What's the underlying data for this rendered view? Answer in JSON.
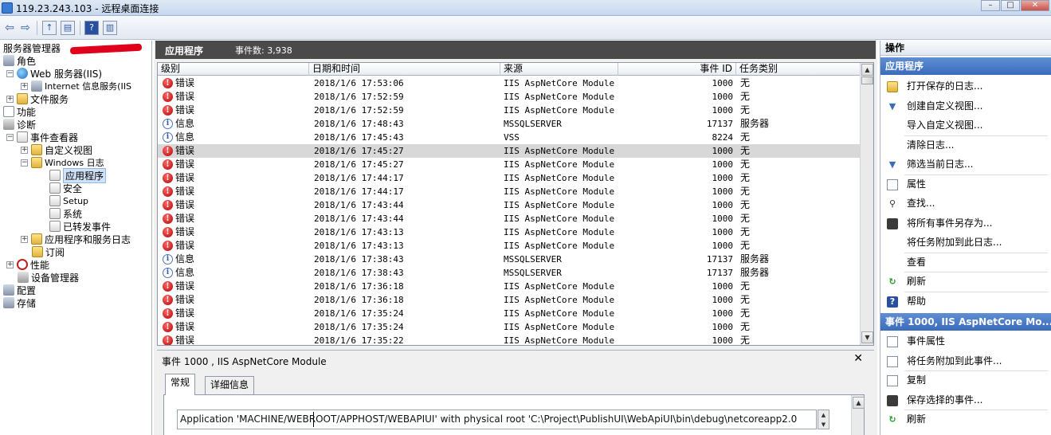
{
  "window": {
    "title": "119.23.243.103 - 远程桌面连接"
  },
  "tree": {
    "root": "服务器管理器",
    "items": [
      {
        "label": "角色"
      },
      {
        "label": "Web 服务器(IIS)"
      },
      {
        "label": "Internet 信息服务(IIS"
      },
      {
        "label": "文件服务"
      },
      {
        "label": "功能"
      },
      {
        "label": "诊断"
      },
      {
        "label": "事件查看器"
      },
      {
        "label": "自定义视图"
      },
      {
        "label": "Windows 日志"
      },
      {
        "label": "应用程序"
      },
      {
        "label": "安全"
      },
      {
        "label": "Setup"
      },
      {
        "label": "系统"
      },
      {
        "label": "已转发事件"
      },
      {
        "label": "应用程序和服务日志"
      },
      {
        "label": "订阅"
      },
      {
        "label": "性能"
      },
      {
        "label": "设备管理器"
      },
      {
        "label": "配置"
      },
      {
        "label": "存储"
      }
    ]
  },
  "center": {
    "title": "应用程序",
    "count_text": "事件数: 3,938",
    "columns": {
      "level": "级别",
      "datetime": "日期和时间",
      "source": "来源",
      "event_id": "事件 ID",
      "task": "任务类别"
    },
    "rows": [
      {
        "level": "错误",
        "datetime": "2018/1/6 17:53:06",
        "source": "IIS AspNetCore Module",
        "event_id": "1000",
        "task": "无"
      },
      {
        "level": "错误",
        "datetime": "2018/1/6 17:52:59",
        "source": "IIS AspNetCore Module",
        "event_id": "1000",
        "task": "无"
      },
      {
        "level": "错误",
        "datetime": "2018/1/6 17:52:59",
        "source": "IIS AspNetCore Module",
        "event_id": "1000",
        "task": "无"
      },
      {
        "level": "信息",
        "datetime": "2018/1/6 17:48:43",
        "source": "MSSQLSERVER",
        "event_id": "17137",
        "task": "服务器"
      },
      {
        "level": "信息",
        "datetime": "2018/1/6 17:45:43",
        "source": "VSS",
        "event_id": "8224",
        "task": "无"
      },
      {
        "level": "错误",
        "datetime": "2018/1/6 17:45:27",
        "source": "IIS AspNetCore Module",
        "event_id": "1000",
        "task": "无"
      },
      {
        "level": "错误",
        "datetime": "2018/1/6 17:45:27",
        "source": "IIS AspNetCore Module",
        "event_id": "1000",
        "task": "无"
      },
      {
        "level": "错误",
        "datetime": "2018/1/6 17:44:17",
        "source": "IIS AspNetCore Module",
        "event_id": "1000",
        "task": "无"
      },
      {
        "level": "错误",
        "datetime": "2018/1/6 17:44:17",
        "source": "IIS AspNetCore Module",
        "event_id": "1000",
        "task": "无"
      },
      {
        "level": "错误",
        "datetime": "2018/1/6 17:43:44",
        "source": "IIS AspNetCore Module",
        "event_id": "1000",
        "task": "无"
      },
      {
        "level": "错误",
        "datetime": "2018/1/6 17:43:44",
        "source": "IIS AspNetCore Module",
        "event_id": "1000",
        "task": "无"
      },
      {
        "level": "错误",
        "datetime": "2018/1/6 17:43:13",
        "source": "IIS AspNetCore Module",
        "event_id": "1000",
        "task": "无"
      },
      {
        "level": "错误",
        "datetime": "2018/1/6 17:43:13",
        "source": "IIS AspNetCore Module",
        "event_id": "1000",
        "task": "无"
      },
      {
        "level": "信息",
        "datetime": "2018/1/6 17:38:43",
        "source": "MSSQLSERVER",
        "event_id": "17137",
        "task": "服务器"
      },
      {
        "level": "信息",
        "datetime": "2018/1/6 17:38:43",
        "source": "MSSQLSERVER",
        "event_id": "17137",
        "task": "服务器"
      },
      {
        "level": "错误",
        "datetime": "2018/1/6 17:36:18",
        "source": "IIS AspNetCore Module",
        "event_id": "1000",
        "task": "无"
      },
      {
        "level": "错误",
        "datetime": "2018/1/6 17:36:18",
        "source": "IIS AspNetCore Module",
        "event_id": "1000",
        "task": "无"
      },
      {
        "level": "错误",
        "datetime": "2018/1/6 17:35:24",
        "source": "IIS AspNetCore Module",
        "event_id": "1000",
        "task": "无"
      },
      {
        "level": "错误",
        "datetime": "2018/1/6 17:35:24",
        "source": "IIS AspNetCore Module",
        "event_id": "1000",
        "task": "无"
      },
      {
        "level": "错误",
        "datetime": "2018/1/6 17:35:22",
        "source": "IIS AspNetCore Module",
        "event_id": "1000",
        "task": "无"
      }
    ]
  },
  "detail": {
    "title": "事件 1000 , IIS AspNetCore Module",
    "tabs": [
      "常规",
      "详细信息"
    ],
    "message": "Application 'MACHINE/WEBROOT/APPHOST/WEBAPIUI' with physical root 'C:\\Project\\PublishUI\\WebApiUI\\bin\\debug\\netcoreapp2.0"
  },
  "actions": {
    "header": "操作",
    "section1": "应用程序",
    "items1": [
      {
        "label": "打开保存的日志...",
        "icon": "folder-open-icon"
      },
      {
        "label": "创建自定义视图...",
        "icon": "filter-icon"
      },
      {
        "label": "导入自定义视图...",
        "icon": ""
      },
      {
        "label": "清除日志...",
        "icon": ""
      },
      {
        "label": "筛选当前日志...",
        "icon": "filter-icon"
      },
      {
        "label": "属性",
        "icon": "properties-icon"
      },
      {
        "label": "查找...",
        "icon": "binoculars-icon"
      },
      {
        "label": "将所有事件另存为...",
        "icon": "save-icon"
      },
      {
        "label": "将任务附加到此日志...",
        "icon": ""
      },
      {
        "label": "查看",
        "icon": ""
      },
      {
        "label": "刷新",
        "icon": "refresh-icon"
      },
      {
        "label": "帮助",
        "icon": "help-icon"
      }
    ],
    "section2": "事件 1000, IIS AspNetCore Mo...",
    "items2": [
      {
        "label": "事件属性",
        "icon": "properties-icon"
      },
      {
        "label": "将任务附加到此事件...",
        "icon": "task-icon"
      },
      {
        "label": "复制",
        "icon": "copy-icon"
      },
      {
        "label": "保存选择的事件...",
        "icon": "save-icon"
      },
      {
        "label": "刷新",
        "icon": "refresh-icon"
      }
    ]
  },
  "colors": {
    "error": "#c00000",
    "info": "#2f5aa8",
    "section_blue": "#3a6cbc",
    "header_dark": "#4a4a4a"
  }
}
